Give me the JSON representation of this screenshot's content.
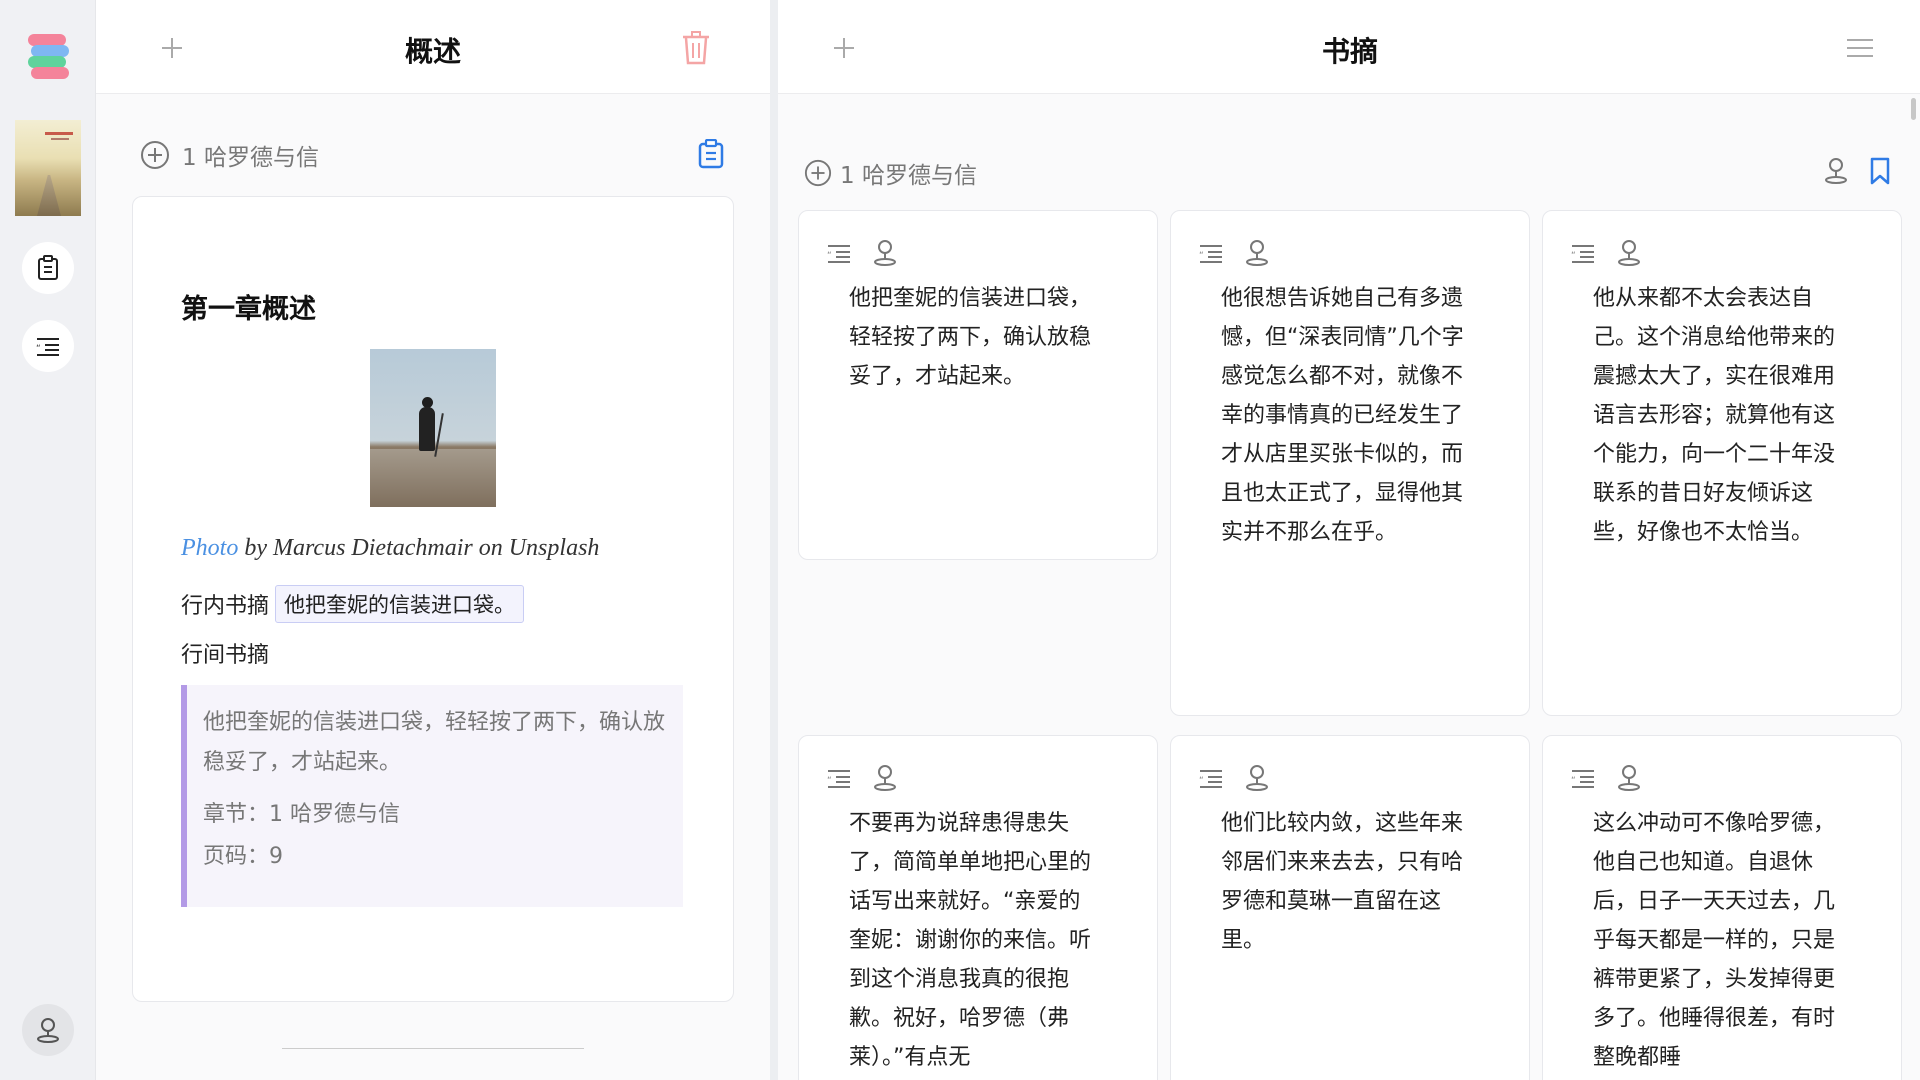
{
  "left": {
    "title": "概述",
    "chapter_label": "1 哈罗德与信",
    "summary": {
      "heading": "第一章概述",
      "caption_link": "Photo",
      "caption_rest": " by Marcus Dietachmair on Unsplash",
      "inline_label": "行内书摘",
      "inline_quote": "他把奎妮的信装进口袋。",
      "between_label": "行间书摘",
      "quote_text": "他把奎妮的信装进口袋，轻轻按了两下，确认放稳妥了，才站起来。",
      "quote_chapter": "章节：1 哈罗德与信",
      "quote_page": "页码：9"
    }
  },
  "right": {
    "title": "书摘",
    "chapter_label": "1 哈罗德与信",
    "cards": [
      {
        "text": "他把奎妮的信装进口袋，轻轻按了两下，确认放稳妥了，才站起来。"
      },
      {
        "text": "他很想告诉她自己有多遗憾，但“深表同情”几个字感觉怎么都不对，就像不幸的事情真的已经发生了才从店里买张卡似的，而且也太正式了，显得他其实并不那么在乎。"
      },
      {
        "text": "他从来都不太会表达自己。这个消息给他带来的震撼太大了，实在很难用语言去形容；就算他有这个能力，向一个二十年没联系的昔日好友倾诉这些，好像也不太恰当。"
      },
      {
        "text": "不要再为说辞患得患失了，简简单单地把心里的话写出来就好。“亲爱的奎妮：谢谢你的来信。听到这个消息我真的很抱歉。祝好，哈罗德（弗莱）。”有点无"
      },
      {
        "text": "他们比较内敛，这些年来邻居们来来去去，只有哈罗德和莫琳一直留在这里。"
      },
      {
        "text": "这么冲动可不像哈罗德，他自己也知道。自退休后，日子一天天过去，几乎每天都是一样的，只是裤带更紧了，头发掉得更多了。他睡得很差，有时整晚都睡"
      }
    ]
  },
  "colors": {
    "accent": "#4a90e2",
    "quote_bar": "#b39ae6",
    "trash": "#f4a5a5"
  }
}
